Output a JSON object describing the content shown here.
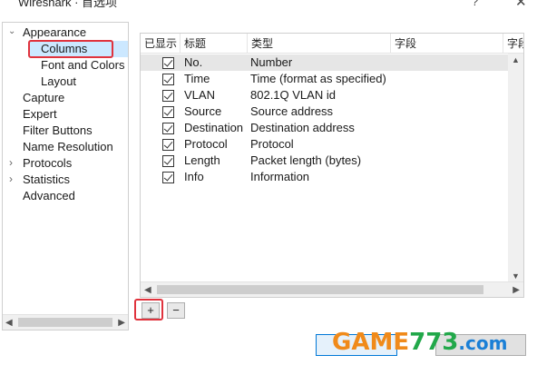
{
  "window": {
    "title": "Wireshark · 首选项",
    "help": "?",
    "close": "✕"
  },
  "tree": {
    "items": [
      {
        "label": "Appearance",
        "arrow": "⌄",
        "level": 0
      },
      {
        "label": "Columns",
        "level": 1,
        "selected": true
      },
      {
        "label": "Font and Colors",
        "level": 1
      },
      {
        "label": "Layout",
        "level": 1
      },
      {
        "label": "Capture",
        "level": 0
      },
      {
        "label": "Expert",
        "level": 0
      },
      {
        "label": "Filter Buttons",
        "level": 0
      },
      {
        "label": "Name Resolution",
        "level": 0
      },
      {
        "label": "Protocols",
        "arrow": "›",
        "level": 0
      },
      {
        "label": "Statistics",
        "arrow": "›",
        "level": 0
      },
      {
        "label": "Advanced",
        "level": 0
      }
    ]
  },
  "columns_table": {
    "headers": [
      "已显示",
      "标题",
      "类型",
      "字段",
      "字段"
    ],
    "rows": [
      {
        "shown": true,
        "title": "No.",
        "type": "Number",
        "selected": true
      },
      {
        "shown": true,
        "title": "Time",
        "type": "Time (format as specified)"
      },
      {
        "shown": true,
        "title": "VLAN",
        "type": "802.1Q VLAN id"
      },
      {
        "shown": true,
        "title": "Source",
        "type": "Source address"
      },
      {
        "shown": true,
        "title": "Destination",
        "type": "Destination address"
      },
      {
        "shown": true,
        "title": "Protocol",
        "type": "Protocol"
      },
      {
        "shown": true,
        "title": "Length",
        "type": "Packet length (bytes)"
      },
      {
        "shown": true,
        "title": "Info",
        "type": "Information"
      }
    ]
  },
  "buttons": {
    "add": "+",
    "remove": "−"
  },
  "watermark": {
    "game": "GAME",
    "num": "773",
    "com": ".com"
  },
  "colors": {
    "highlight": "#e0333d",
    "selection": "#cce8ff",
    "watermark_orange": "#f08a1a",
    "watermark_green": "#22a84a",
    "watermark_blue": "#1a7fd6"
  }
}
